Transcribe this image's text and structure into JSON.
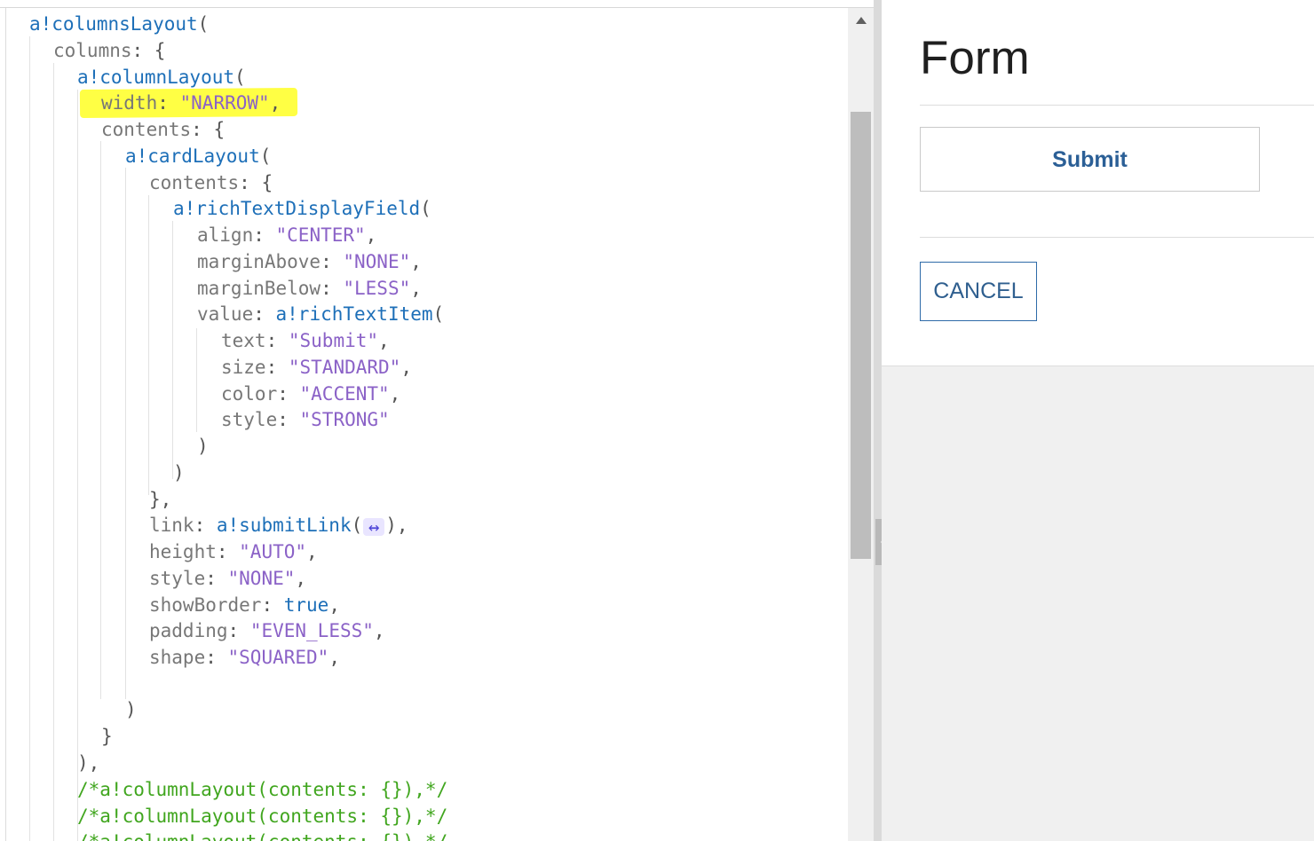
{
  "code_editor": {
    "fold_marker": "↔",
    "lines": [
      [
        {
          "text": "a!columnsLayout",
          "type": "fn"
        },
        {
          "text": "(",
          "type": "punc"
        }
      ],
      [
        {
          "text": "columns",
          "type": "key"
        },
        {
          "text": ": {",
          "type": "punc"
        }
      ],
      [
        {
          "text": "a!columnLayout",
          "type": "fn"
        },
        {
          "text": "(",
          "type": "punc"
        }
      ],
      [
        {
          "text": "width",
          "type": "key"
        },
        {
          "text": ": ",
          "type": "punc"
        },
        {
          "text": "\"NARROW\"",
          "type": "str"
        },
        {
          "text": ",",
          "type": "punc"
        }
      ],
      [
        {
          "text": "contents",
          "type": "key"
        },
        {
          "text": ": {",
          "type": "punc"
        }
      ],
      [
        {
          "text": "a!cardLayout",
          "type": "fn"
        },
        {
          "text": "(",
          "type": "punc"
        }
      ],
      [
        {
          "text": "contents",
          "type": "key"
        },
        {
          "text": ": {",
          "type": "punc"
        }
      ],
      [
        {
          "text": "a!richTextDisplayField",
          "type": "fn"
        },
        {
          "text": "(",
          "type": "punc"
        }
      ],
      [
        {
          "text": "align",
          "type": "key"
        },
        {
          "text": ": ",
          "type": "punc"
        },
        {
          "text": "\"CENTER\"",
          "type": "str"
        },
        {
          "text": ",",
          "type": "punc"
        }
      ],
      [
        {
          "text": "marginAbove",
          "type": "key"
        },
        {
          "text": ": ",
          "type": "punc"
        },
        {
          "text": "\"NONE\"",
          "type": "str"
        },
        {
          "text": ",",
          "type": "punc"
        }
      ],
      [
        {
          "text": "marginBelow",
          "type": "key"
        },
        {
          "text": ": ",
          "type": "punc"
        },
        {
          "text": "\"LESS\"",
          "type": "str"
        },
        {
          "text": ",",
          "type": "punc"
        }
      ],
      [
        {
          "text": "value",
          "type": "key"
        },
        {
          "text": ": ",
          "type": "punc"
        },
        {
          "text": "a!richTextItem",
          "type": "fn"
        },
        {
          "text": "(",
          "type": "punc"
        }
      ],
      [
        {
          "text": "text",
          "type": "key"
        },
        {
          "text": ": ",
          "type": "punc"
        },
        {
          "text": "\"Submit\"",
          "type": "str"
        },
        {
          "text": ",",
          "type": "punc"
        }
      ],
      [
        {
          "text": "size",
          "type": "key"
        },
        {
          "text": ": ",
          "type": "punc"
        },
        {
          "text": "\"STANDARD\"",
          "type": "str"
        },
        {
          "text": ",",
          "type": "punc"
        }
      ],
      [
        {
          "text": "color",
          "type": "key"
        },
        {
          "text": ": ",
          "type": "punc"
        },
        {
          "text": "\"ACCENT\"",
          "type": "str"
        },
        {
          "text": ",",
          "type": "punc"
        }
      ],
      [
        {
          "text": "style",
          "type": "key"
        },
        {
          "text": ": ",
          "type": "punc"
        },
        {
          "text": "\"STRONG\"",
          "type": "str"
        }
      ],
      [
        {
          "text": ")",
          "type": "punc"
        }
      ],
      [
        {
          "text": ")",
          "type": "punc"
        }
      ],
      [
        {
          "text": "},",
          "type": "punc"
        }
      ],
      [
        {
          "text": "link",
          "type": "key"
        },
        {
          "text": ": ",
          "type": "punc"
        },
        {
          "text": "a!submitLink",
          "type": "fn"
        },
        {
          "text": "(",
          "type": "punc"
        },
        {
          "text": "",
          "type": "fold"
        },
        {
          "text": "),",
          "type": "punc"
        }
      ],
      [
        {
          "text": "height",
          "type": "key"
        },
        {
          "text": ": ",
          "type": "punc"
        },
        {
          "text": "\"AUTO\"",
          "type": "str"
        },
        {
          "text": ",",
          "type": "punc"
        }
      ],
      [
        {
          "text": "style",
          "type": "key"
        },
        {
          "text": ": ",
          "type": "punc"
        },
        {
          "text": "\"NONE\"",
          "type": "str"
        },
        {
          "text": ",",
          "type": "punc"
        }
      ],
      [
        {
          "text": "showBorder",
          "type": "key"
        },
        {
          "text": ": ",
          "type": "punc"
        },
        {
          "text": "true",
          "type": "bool"
        },
        {
          "text": ",",
          "type": "punc"
        }
      ],
      [
        {
          "text": "padding",
          "type": "key"
        },
        {
          "text": ": ",
          "type": "punc"
        },
        {
          "text": "\"EVEN_LESS\"",
          "type": "str"
        },
        {
          "text": ",",
          "type": "punc"
        }
      ],
      [
        {
          "text": "shape",
          "type": "key"
        },
        {
          "text": ": ",
          "type": "punc"
        },
        {
          "text": "\"SQUARED\"",
          "type": "str"
        },
        {
          "text": ",",
          "type": "punc"
        }
      ],
      [],
      [
        {
          "text": ")",
          "type": "punc"
        }
      ],
      [
        {
          "text": "}",
          "type": "punc"
        }
      ],
      [
        {
          "text": "),",
          "type": "punc"
        }
      ],
      [
        {
          "text": "/*a!columnLayout(contents: {}),*/",
          "type": "comment"
        }
      ],
      [
        {
          "text": "/*a!columnLayout(contents: {}),*/",
          "type": "comment"
        }
      ],
      [
        {
          "text": "/*a!columnLayout(contents: {}),*/",
          "type": "comment"
        }
      ]
    ]
  },
  "preview": {
    "title": "Form",
    "submit_label": "Submit",
    "cancel_label": "CANCEL"
  },
  "colors": {
    "highlight": "#ffff3a",
    "accent": "#2b5f96",
    "comment": "#41a61f",
    "string": "#8b62c7",
    "function": "#1d6fb8"
  },
  "icons": {
    "collapse": "left-arrow-icon",
    "scroll_up": "triangle-up-icon"
  }
}
